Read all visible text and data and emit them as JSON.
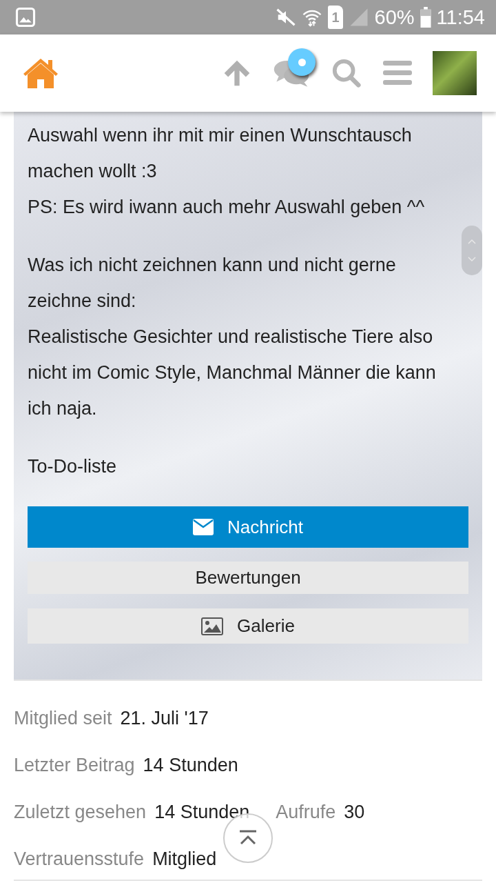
{
  "status_bar": {
    "sim_slot": "1",
    "battery": "60%",
    "time": "11:54"
  },
  "header": {
    "notification_badge": true
  },
  "bio": [
    [
      "Auswahl wenn ihr mit mir einen Wunschtausch machen wollt :3",
      "PS: Es wird iwann auch mehr Auswahl geben ^^"
    ],
    [
      "Was ich nicht zeichnen kann und nicht gerne zeichne sind:",
      "Realistische Gesichter und realistische Tiere also nicht im Comic Style, Manchmal Männer die kann ich naja."
    ],
    [
      "To-Do-liste"
    ]
  ],
  "buttons": [
    {
      "label": "Nachricht",
      "kind": "primary"
    },
    {
      "label": "Bewertungen",
      "kind": "plain"
    },
    {
      "label": "Galerie",
      "kind": "gallery"
    }
  ],
  "stats": [
    [
      {
        "label": "Mitglied seit",
        "value": "21. Juli '17"
      }
    ],
    [
      {
        "label": "Letzter Beitrag",
        "value": "14 Stunden"
      }
    ],
    [
      {
        "label": "Zuletzt gesehen",
        "value": "14 Stunden"
      },
      {
        "label": "Aufrufe",
        "value": "30"
      }
    ],
    [
      {
        "label": "Vertrauensstufe",
        "value": "Mitglied"
      }
    ]
  ]
}
